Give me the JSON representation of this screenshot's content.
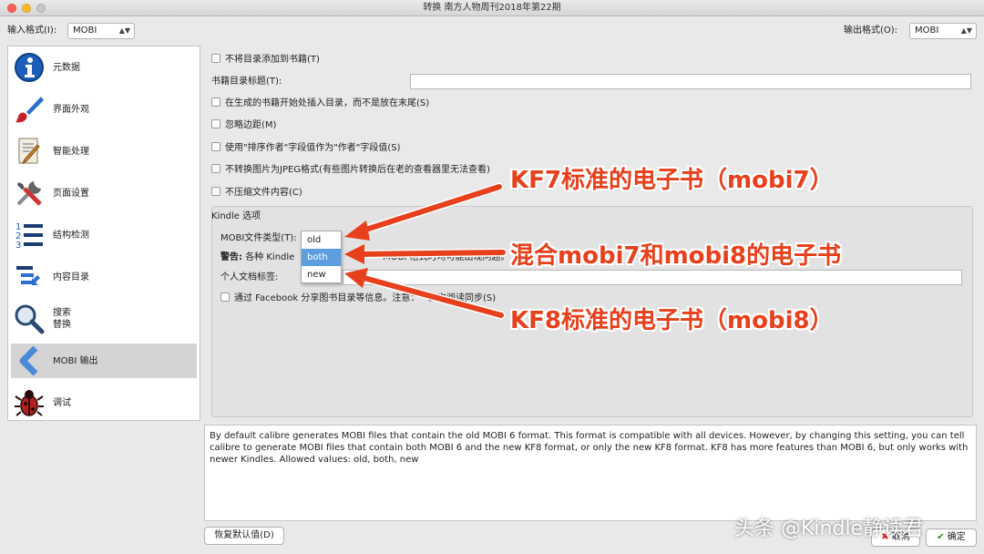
{
  "window": {
    "title": "转换 南方人物周刊2018年第22期"
  },
  "input_format": {
    "label": "输入格式(I):",
    "value": "MOBI"
  },
  "output_format": {
    "label": "输出格式(O):",
    "value": "MOBI"
  },
  "sidebar": {
    "items": [
      {
        "label": "元数据",
        "icon": "info-icon"
      },
      {
        "label": "界面外观",
        "icon": "brush-icon"
      },
      {
        "label": "智能处理",
        "icon": "document-edit-icon"
      },
      {
        "label": "页面设置",
        "icon": "tools-icon"
      },
      {
        "label": "结构检测",
        "icon": "numbered-list-icon"
      },
      {
        "label": "内容目录",
        "icon": "toc-icon"
      },
      {
        "label": "搜索\n替换",
        "icon": "magnifier-icon"
      },
      {
        "label": "MOBI 输出",
        "icon": "chevron-left-icon"
      },
      {
        "label": "调试",
        "icon": "bug-icon"
      }
    ],
    "selected": "MOBI 输出"
  },
  "options": {
    "no_toc": "不将目录添加到书籍(T)",
    "toc_title_label": "书籍目录标题(T):",
    "toc_at_start": "在生成的书籍开始处插入目录，而不是放在末尾(S)",
    "ignore_margins": "忽略边距(M)",
    "author_sort": "使用\"排序作者\"字段值作为\"作者\"字段值(S)",
    "no_jpeg": "不转换图片为JPEG格式(有些图片转换后在老的查看器里无法查看)",
    "no_compress": "不压缩文件内容(C)"
  },
  "kindle": {
    "section": "Kindle 选项",
    "file_type_label": "MOBI文件类型(T):",
    "file_type_options": [
      "old",
      "both",
      "new"
    ],
    "file_type_selected": "both",
    "warning_prefix": "警告:",
    "warning_text_left": "各种 Kindle",
    "warning_text_right": "MOBI 格式时均可能出现问题。",
    "personal_doc_label": "个人文档标签:",
    "facebook_left": "通过 Facebook 分享图书目录等信息。注意：",
    "facebook_right": "上次阅读同步(S)"
  },
  "annotations": {
    "mobi7": "KF7标准的电子书（mobi7）",
    "mixed": "混合mobi7和mobi8的电子书",
    "mobi8": "KF8标准的电子书（mobi8）"
  },
  "help_text": "By default calibre generates MOBI files that contain the old MOBI 6 format. This format is compatible with all devices. However, by changing this setting, you can tell calibre to generate MOBI files that contain both MOBI 6 and the new KF8 format, or only the new KF8 format. KF8 has more features than MOBI 6, but only works with newer Kindles. Allowed values: old, both, new",
  "buttons": {
    "restore_defaults": "恢复默认值(D)",
    "cancel": "取消",
    "ok": "确定"
  },
  "watermark": "头条 @Kindle静读君",
  "colors": {
    "annotation": "#e8401c",
    "selection": "#5c9ee0"
  }
}
